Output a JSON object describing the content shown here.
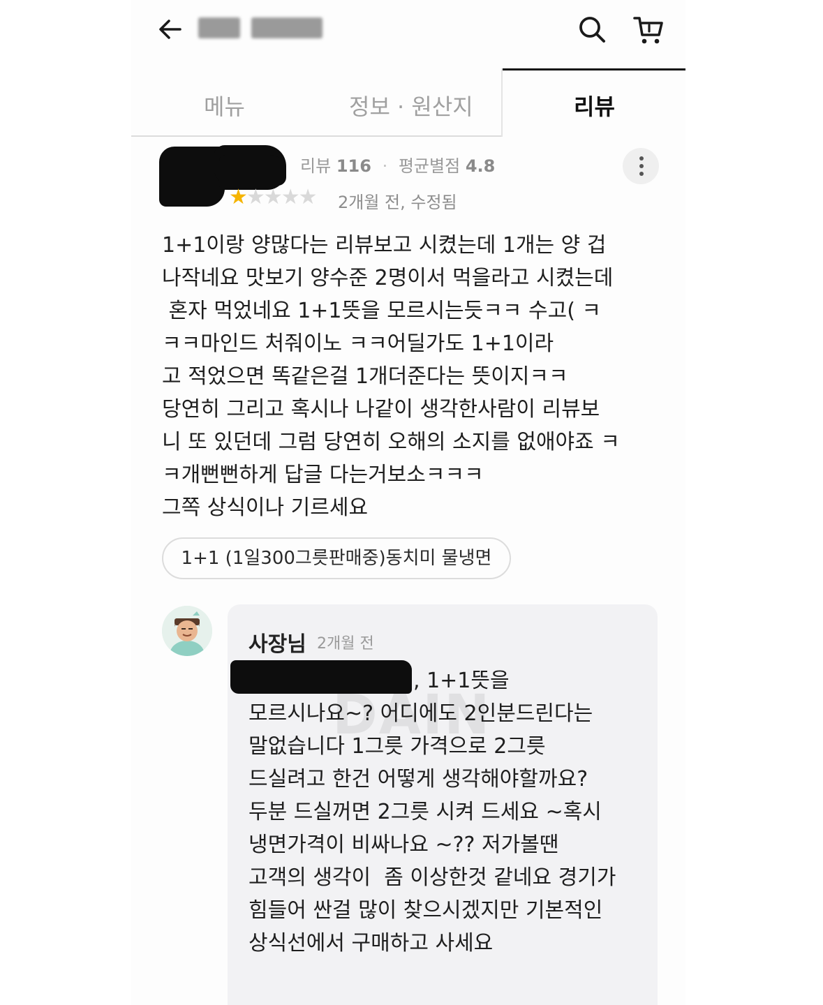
{
  "header": {
    "back_icon": "arrow-left-icon",
    "search_icon": "search-icon",
    "cart_icon": "cart-icon"
  },
  "tabs": [
    {
      "label": "메뉴",
      "active": false
    },
    {
      "label": "정보 · 원산지",
      "active": false
    },
    {
      "label": "리뷰",
      "active": true
    }
  ],
  "review": {
    "meta_review_label": "리뷰",
    "meta_review_count": "116",
    "meta_rating_label": "평균별점",
    "meta_rating_value": "4.8",
    "rating": 1,
    "date": "2개월 전, 수정됨",
    "lines": [
      "1+1이랑 양많다는 리뷰보고 시켰는데 1개는 양 겁",
      "나작네요 맛보기 양수준 2명이서 먹을라고 시켰는데",
      " 혼자 먹었네요 1+1뜻을 모르시는듯ㅋㅋ 수고( ㅋ",
      "ㅋㅋ마인드 처줘이노 ㅋㅋ어딜가도 1+1이라",
      "고 적었으면 똑같은걸 1개더준다는 뜻이지ㅋㅋ",
      "당연히 그리고 혹시나 나같이 생각한사람이 리뷰보",
      "니 또 있던데 그럼 당연히 오해의 소지를 없애야죠 ㅋ",
      "ㅋ개뻔뻔하게 답글 다는거보소ㅋㅋㅋ",
      "그쪽 상식이나 기르세요"
    ],
    "menu_chip": "1+1 (1일300그릇판매중)동치미 물냉면"
  },
  "reply": {
    "owner_name": "사장님",
    "date": "2개월 전",
    "lines": [
      ", 1+1뜻을",
      "모르시나요~? 어디에도 2인분드린다는",
      "말없습니다 1그릇 가격으로 2그릇",
      "드실려고 한건 어떻게 생각해야할까요?",
      "두분 드실꺼면 2그릇 시켜 드세요 ~혹시",
      "냉면가격이 비싸나요 ~?? 저가볼땐",
      "고객의 생각이  좀 이상한것 같네요 경기가",
      "힘들어 싼걸 많이 찾으시겠지만 기본적인",
      "상식선에서 구매하고 사세요"
    ],
    "watermark": "DAIN"
  }
}
